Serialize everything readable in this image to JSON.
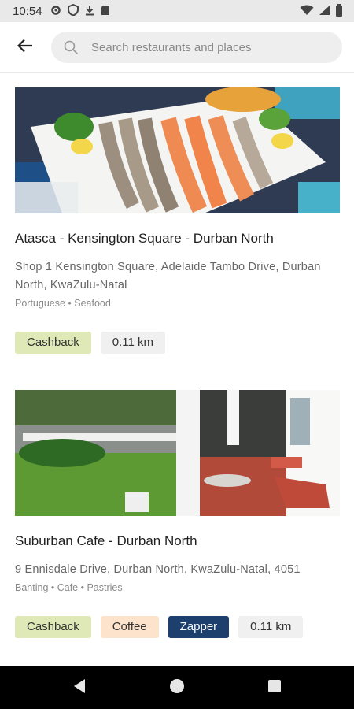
{
  "status_bar": {
    "time": "10:54",
    "icons_left": [
      "settings-icon",
      "shield-icon",
      "download-icon",
      "sd-card-icon"
    ],
    "icons_right": [
      "wifi-icon",
      "signal-icon",
      "battery-icon"
    ]
  },
  "search": {
    "placeholder": "Search restaurants and places",
    "value": ""
  },
  "restaurants": [
    {
      "name": "Atasca - Kensington Square - Durban North",
      "address": "Shop 1 Kensington Square, Adelaide Tambo Drive, Durban North, KwaZulu-Natal",
      "tags": "Portuguese • Seafood",
      "chips": [
        "Cashback",
        "0.11 km"
      ]
    },
    {
      "name": "Suburban Cafe - Durban North",
      "address": "9 Ennisdale Drive, Durban North, KwaZulu-Natal, 4051",
      "tags": "Banting • Cafe • Pastries",
      "chips": [
        "Cashback",
        "Coffee",
        "Zapper",
        "0.11 km"
      ]
    }
  ],
  "colors": {
    "cashback": "#dfe9b8",
    "coffee": "#fde3cc",
    "zapper": "#1c3f6e",
    "distance": "#f0f0f0"
  },
  "nav": [
    "back-nav-icon",
    "home-nav-icon",
    "recents-nav-icon"
  ]
}
